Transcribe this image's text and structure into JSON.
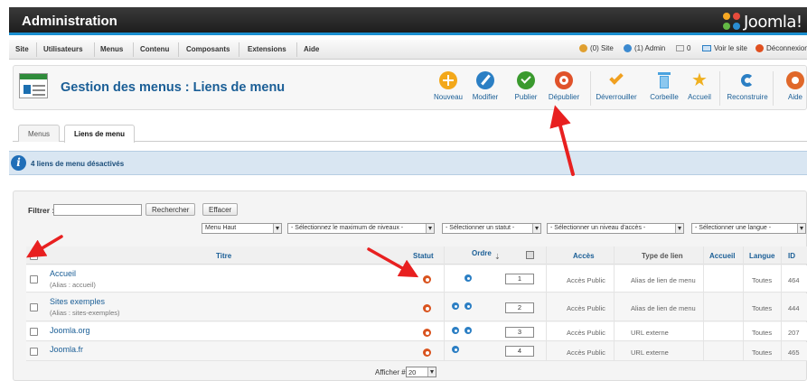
{
  "header": {
    "title": "Administration",
    "logo_text": "Joomla!"
  },
  "menubar": {
    "items": [
      "Site",
      "Utilisateurs",
      "Menus",
      "Contenu",
      "Composants",
      "Extensions",
      "Aide"
    ],
    "status": {
      "site": "(0) Site",
      "admin": "(1) Admin",
      "messages": "0",
      "view_site": "Voir le site",
      "logout": "Déconnexion"
    }
  },
  "toolbar": {
    "page_title": "Gestion des menus : Liens de menu",
    "buttons": [
      {
        "label": "Nouveau",
        "icon": "plus-icon",
        "color": "#f3a81a"
      },
      {
        "label": "Modifier",
        "icon": "pencil-icon",
        "color": "#2b7fc4"
      },
      {
        "label": "Publier",
        "icon": "check-circle-icon",
        "color": "#3a9a2e"
      },
      {
        "label": "Dépublier",
        "icon": "unpublish-icon",
        "color": "#e0522a"
      },
      {
        "label": "Déverrouiller",
        "icon": "checkmark-icon",
        "color": "#f0a020"
      },
      {
        "label": "Corbeille",
        "icon": "trash-icon",
        "color": "#4aa3df"
      },
      {
        "label": "Accueil",
        "icon": "star-icon",
        "color": "#f0b020"
      },
      {
        "label": "Reconstruire",
        "icon": "refresh-icon",
        "color": "#2b7fc4"
      },
      {
        "label": "Aide",
        "icon": "help-icon",
        "color": "#e0682a"
      }
    ]
  },
  "tabs": [
    {
      "label": "Menus",
      "active": false
    },
    {
      "label": "Liens de menu",
      "active": true
    }
  ],
  "message": {
    "text": "4 liens de menu désactivés"
  },
  "filters": {
    "label": "Filtrer :",
    "search_button": "Rechercher",
    "clear_button": "Effacer",
    "selects": [
      "Menu Haut",
      "- Sélectionnez le maximum de niveaux -",
      "- Sélectionner un statut -",
      "- Sélectionner un niveau d'accès -",
      "- Sélectionner une langue -"
    ]
  },
  "table": {
    "headers": {
      "title": "Titre",
      "status": "Statut",
      "order": "Ordre",
      "access": "Accès",
      "link_type": "Type de lien",
      "home": "Accueil",
      "language": "Langue",
      "id": "ID"
    },
    "rows": [
      {
        "title": "Accueil",
        "alias": "(Alias : accueil)",
        "order": "1",
        "access": "Accès Public",
        "link_type": "Alias de lien de menu",
        "language": "Toutes",
        "id": "464"
      },
      {
        "title": "Sites exemples",
        "alias": "(Alias : sites-exemples)",
        "order": "2",
        "access": "Accès Public",
        "link_type": "Alias de lien de menu",
        "language": "Toutes",
        "id": "444"
      },
      {
        "title": "Joomla.org",
        "alias": "",
        "order": "3",
        "access": "Accès Public",
        "link_type": "URL externe",
        "language": "Toutes",
        "id": "207"
      },
      {
        "title": "Joomla.fr",
        "alias": "",
        "order": "4",
        "access": "Accès Public",
        "link_type": "URL externe",
        "language": "Toutes",
        "id": "465"
      }
    ]
  },
  "footer": {
    "display_label": "Afficher #",
    "display_value": "20"
  },
  "colors": {
    "accent": "#1a5e96",
    "arrow": "#e82020",
    "header_bg": "#2b2b2b"
  }
}
